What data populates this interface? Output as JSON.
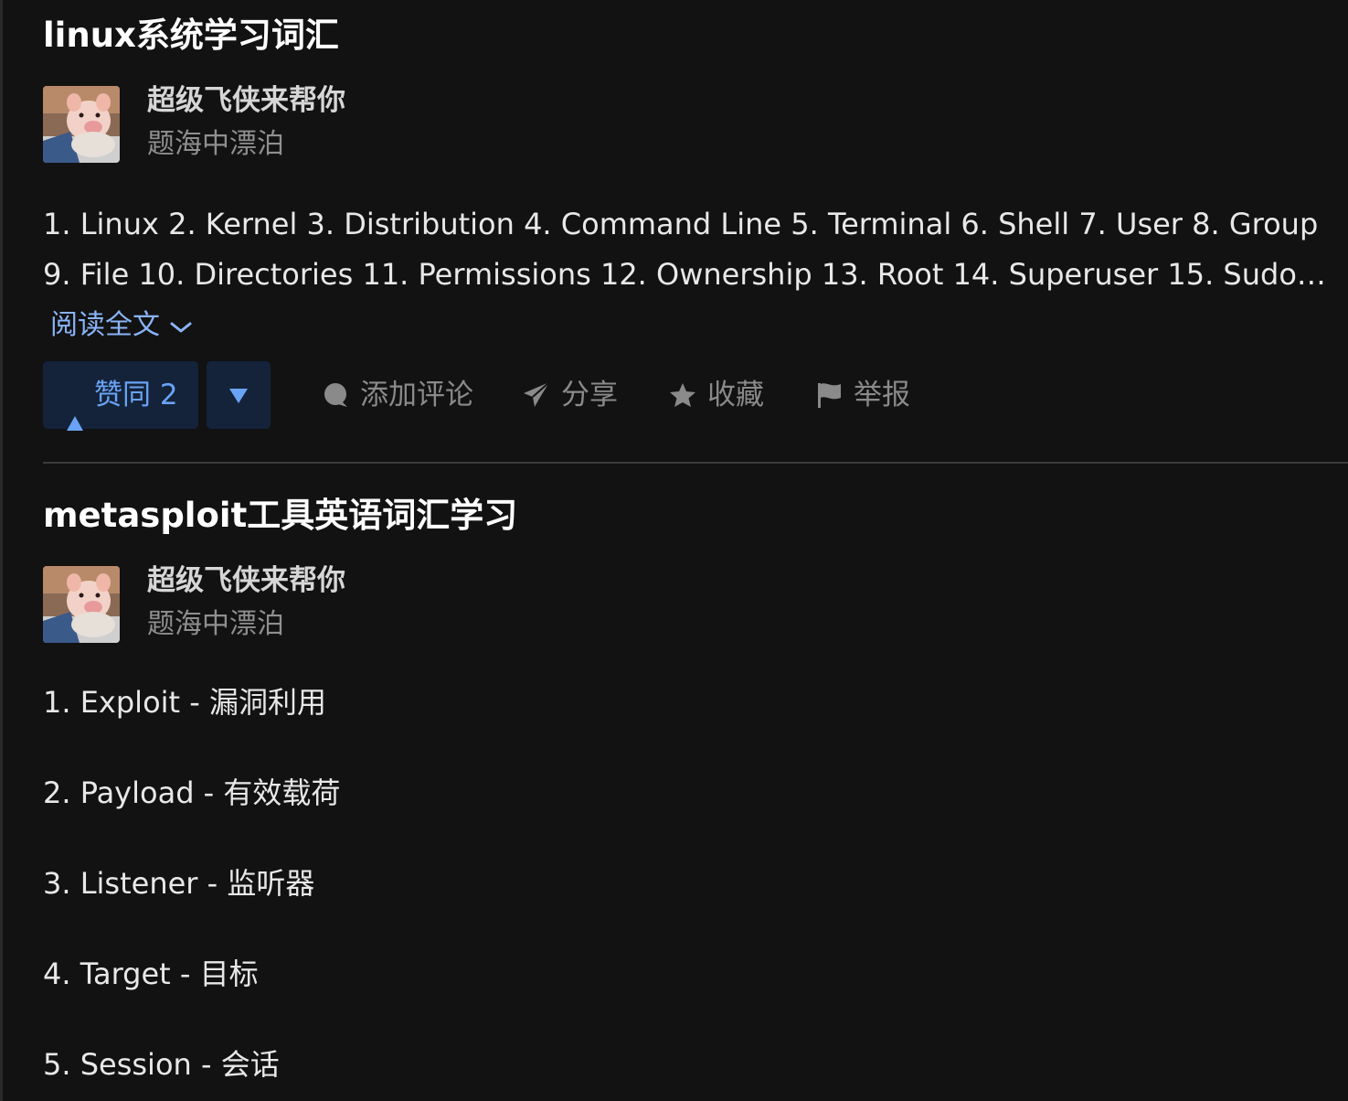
{
  "posts": [
    {
      "title": "linux系统学习词汇",
      "author": {
        "name": "超级飞侠来帮你",
        "bio": "题海中漂泊"
      },
      "excerpt": "1. Linux 2. Kernel 3. Distribution 4. Command Line 5. Terminal 6. Shell 7. User 8. Group 9. File 10. Directories 11. Permissions 12. Ownership 13. Root 14. Superuser 15. Sudo…",
      "read_more": "阅读全文",
      "actions": {
        "upvote": "赞同 2",
        "comment": "添加评论",
        "share": "分享",
        "favorite": "收藏",
        "report": "举报"
      }
    },
    {
      "title": "metasploit工具英语词汇学习",
      "author": {
        "name": "超级飞侠来帮你",
        "bio": "题海中漂泊"
      },
      "items": [
        "1. Exploit - 漏洞利用",
        "2. Payload - 有效载荷",
        "3. Listener - 监听器",
        "4. Target - 目标",
        "5. Session - 会话"
      ]
    }
  ],
  "icons": {
    "read_more": "chevron-down-icon",
    "upvote": "triangle-up-icon",
    "downvote": "triangle-down-icon",
    "comment": "comment-bubble-icon",
    "share": "paper-plane-icon",
    "favorite": "star-icon",
    "report": "flag-icon"
  },
  "colors": {
    "background": "#121212",
    "link": "#8ab4f8",
    "vote_bg": "#14233a",
    "vote_fg": "#6aa3f5"
  }
}
